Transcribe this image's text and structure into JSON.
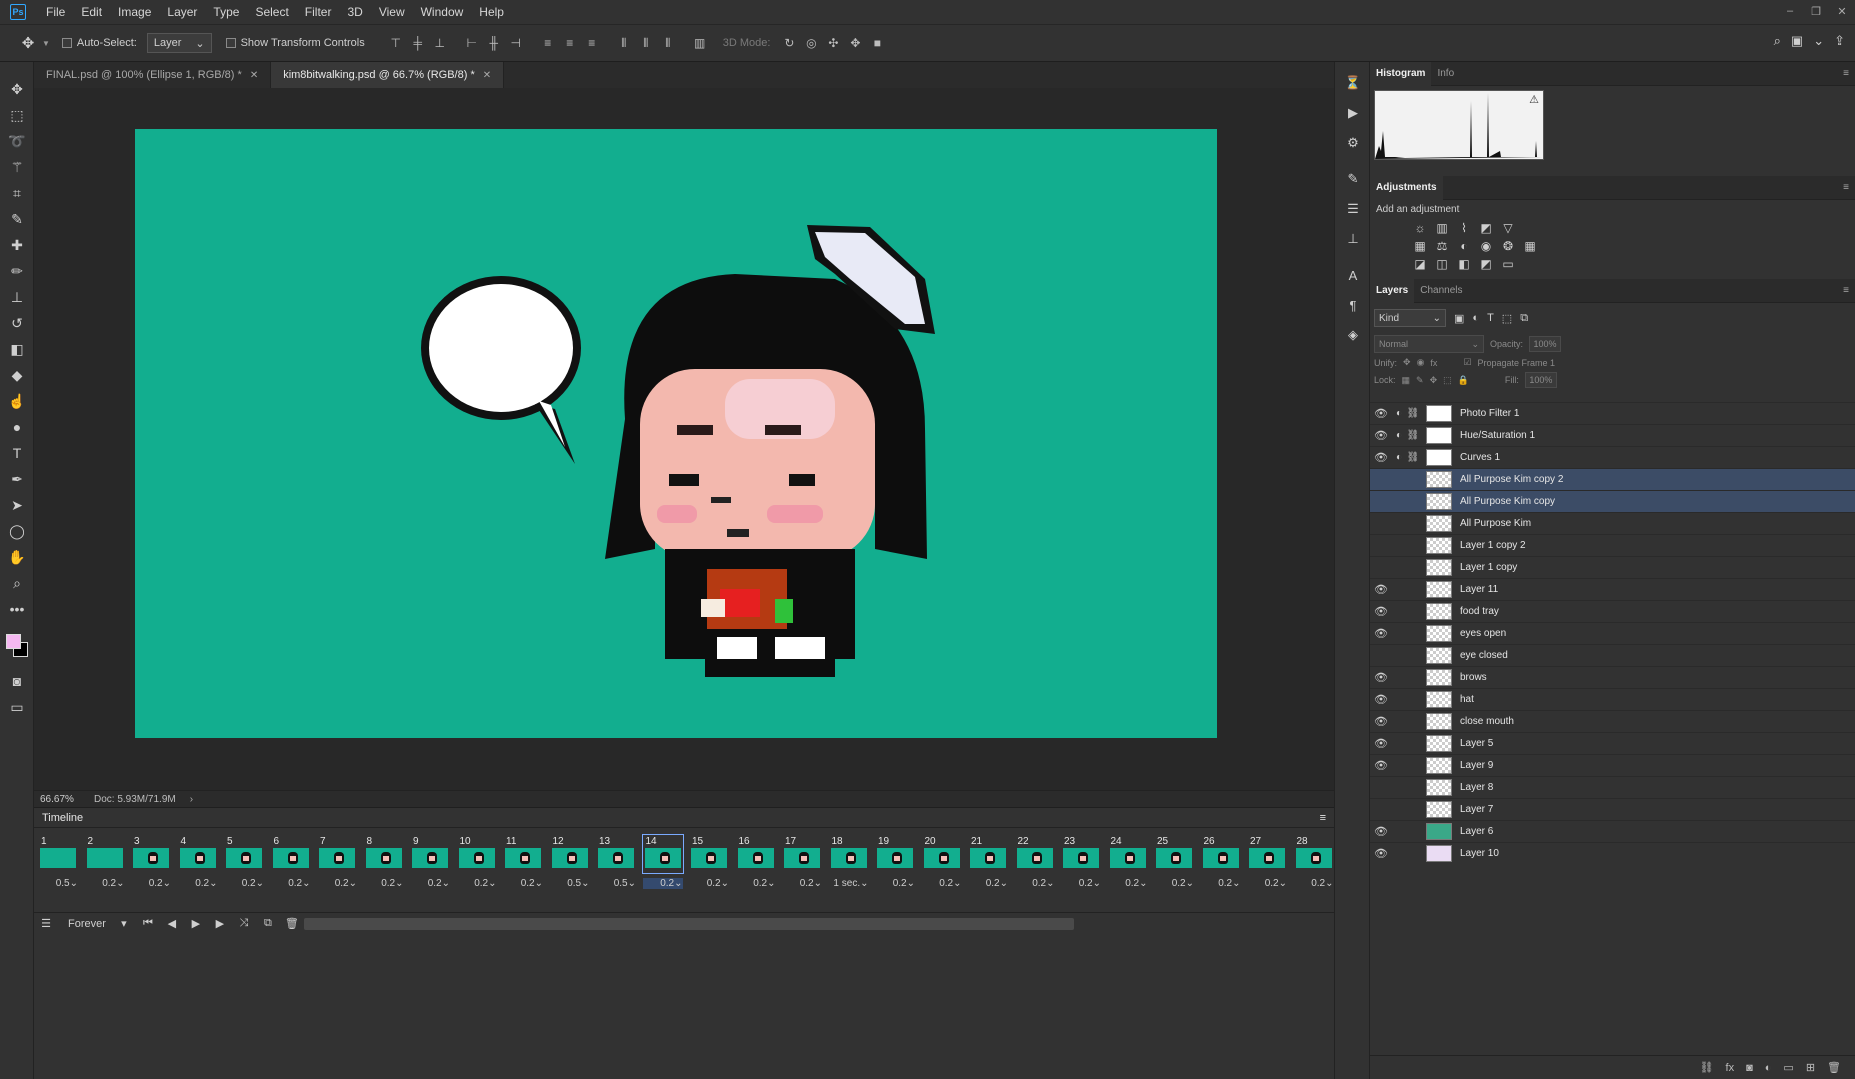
{
  "menu": [
    "File",
    "Edit",
    "Image",
    "Layer",
    "Type",
    "Select",
    "Filter",
    "3D",
    "View",
    "Window",
    "Help"
  ],
  "app_logo": "Ps",
  "window_controls": [
    "–",
    "❐",
    "✕"
  ],
  "options": {
    "auto_select_label": "Auto-Select:",
    "auto_select_value": "Layer",
    "show_transform_label": "Show Transform Controls",
    "mode_3d_label": "3D Mode:"
  },
  "tabs": [
    {
      "label": "FINAL.psd @ 100% (Ellipse 1, RGB/8) *",
      "active": false
    },
    {
      "label": "kim8bitwalking.psd @ 66.7% (RGB/8) *",
      "active": true
    }
  ],
  "status": {
    "zoom": "66.67%",
    "doc": "Doc: 5.93M/71.9M"
  },
  "canvas": {
    "background": "#12ae8f"
  },
  "timeline": {
    "title": "Timeline",
    "loop": "Forever",
    "frames": [
      {
        "n": "1",
        "d": "0.5"
      },
      {
        "n": "2",
        "d": "0.2"
      },
      {
        "n": "3",
        "d": "0.2"
      },
      {
        "n": "4",
        "d": "0.2"
      },
      {
        "n": "5",
        "d": "0.2"
      },
      {
        "n": "6",
        "d": "0.2"
      },
      {
        "n": "7",
        "d": "0.2"
      },
      {
        "n": "8",
        "d": "0.2"
      },
      {
        "n": "9",
        "d": "0.2"
      },
      {
        "n": "10",
        "d": "0.2"
      },
      {
        "n": "11",
        "d": "0.2"
      },
      {
        "n": "12",
        "d": "0.5"
      },
      {
        "n": "13",
        "d": "0.5"
      },
      {
        "n": "14",
        "d": "0.2"
      },
      {
        "n": "15",
        "d": "0.2"
      },
      {
        "n": "16",
        "d": "0.2"
      },
      {
        "n": "17",
        "d": "0.2"
      },
      {
        "n": "18",
        "d": "1 sec."
      },
      {
        "n": "19",
        "d": "0.2"
      },
      {
        "n": "20",
        "d": "0.2"
      },
      {
        "n": "21",
        "d": "0.2"
      },
      {
        "n": "22",
        "d": "0.2"
      },
      {
        "n": "23",
        "d": "0.2"
      },
      {
        "n": "24",
        "d": "0.2"
      },
      {
        "n": "25",
        "d": "0.2"
      },
      {
        "n": "26",
        "d": "0.2"
      },
      {
        "n": "27",
        "d": "0.2"
      },
      {
        "n": "28",
        "d": "0.2"
      }
    ],
    "selected_frame": "14"
  },
  "panels": {
    "histogram_tab": "Histogram",
    "info_tab": "Info",
    "adjustments_tab": "Adjustments",
    "add_adjustment": "Add an adjustment",
    "layers_tab": "Layers",
    "channels_tab": "Channels",
    "kind": "Kind",
    "blend_mode": "Normal",
    "opacity_label": "Opacity:",
    "opacity_value": "100%",
    "unify_label": "Unify:",
    "propagate_label": "Propagate Frame 1",
    "lock_label": "Lock:",
    "fill_label": "Fill:",
    "fill_value": "100%"
  },
  "layers": [
    {
      "name": "Photo Filter 1",
      "visible": true,
      "adj": true,
      "selected": false
    },
    {
      "name": "Hue/Saturation 1",
      "visible": true,
      "adj": true,
      "selected": false
    },
    {
      "name": "Curves 1",
      "visible": true,
      "adj": true,
      "selected": false
    },
    {
      "name": "All Purpose Kim copy 2",
      "visible": false,
      "adj": false,
      "selected": true
    },
    {
      "name": "All Purpose Kim copy",
      "visible": false,
      "adj": false,
      "selected": true
    },
    {
      "name": "All Purpose Kim",
      "visible": false,
      "adj": false,
      "selected": false
    },
    {
      "name": "Layer 1 copy 2",
      "visible": false,
      "adj": false,
      "selected": false
    },
    {
      "name": "Layer 1 copy",
      "visible": false,
      "adj": false,
      "selected": false
    },
    {
      "name": "Layer 11",
      "visible": true,
      "adj": false,
      "selected": false
    },
    {
      "name": "food tray",
      "visible": true,
      "adj": false,
      "selected": false
    },
    {
      "name": "eyes open",
      "visible": true,
      "adj": false,
      "selected": false
    },
    {
      "name": "eye closed",
      "visible": false,
      "adj": false,
      "selected": false
    },
    {
      "name": "brows",
      "visible": true,
      "adj": false,
      "selected": false
    },
    {
      "name": "hat",
      "visible": true,
      "adj": false,
      "selected": false
    },
    {
      "name": "close mouth",
      "visible": true,
      "adj": false,
      "selected": false
    },
    {
      "name": "Layer 5",
      "visible": true,
      "adj": false,
      "selected": false
    },
    {
      "name": "Layer 9",
      "visible": true,
      "adj": false,
      "selected": false
    },
    {
      "name": "Layer 8",
      "visible": false,
      "adj": false,
      "selected": false
    },
    {
      "name": "Layer 7",
      "visible": false,
      "adj": false,
      "selected": false
    },
    {
      "name": "Layer 6",
      "visible": true,
      "adj": false,
      "selected": false
    },
    {
      "name": "Layer 10",
      "visible": true,
      "adj": false,
      "selected": false
    }
  ]
}
